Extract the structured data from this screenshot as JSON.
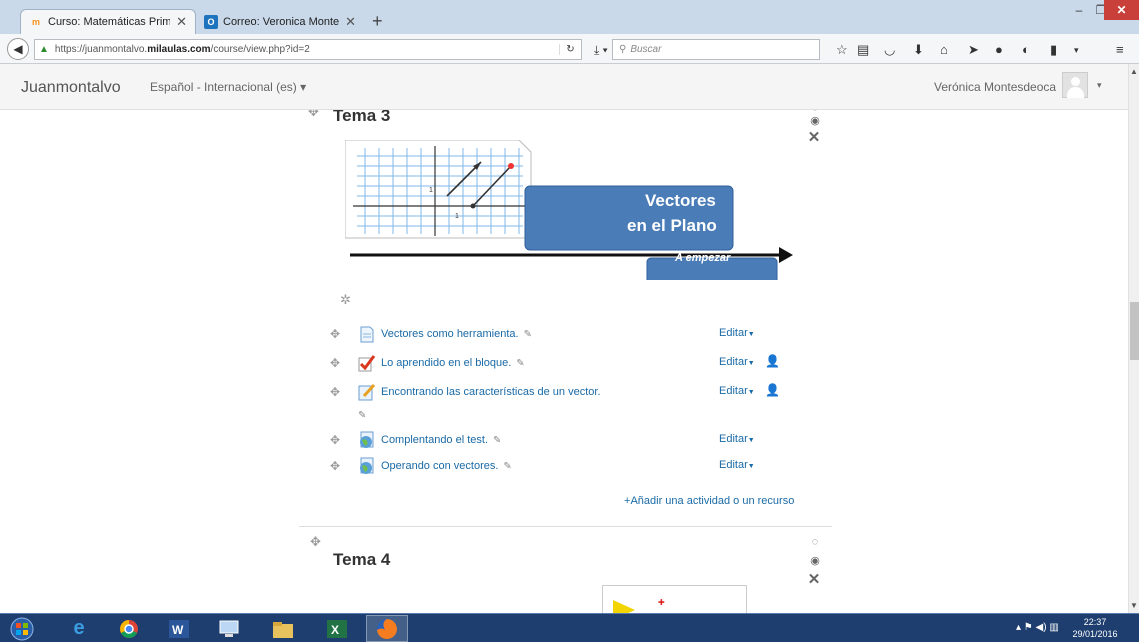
{
  "browser": {
    "tabs": [
      {
        "label": "Curso: Matemáticas Prime...",
        "icon": "moodle-favicon",
        "active": true
      },
      {
        "label": "Correo: Veronica Montesd...",
        "icon": "outlook-favicon",
        "active": false
      }
    ],
    "new_tab_label": "+",
    "close_tab_glyph": "✕",
    "url_prefix": "https://juanmontalvo.",
    "url_domain": "milaulas.com",
    "url_path": "/course/view.php?id=2",
    "search_placeholder": "Buscar",
    "window_controls": {
      "minimize": "–",
      "maximize": "❐",
      "close": "✕"
    }
  },
  "moodle": {
    "site_name": "Juanmontalvo",
    "language": "Español - Internacional (es) ▾",
    "user_name": "Verónica Montesdeoca",
    "user_menu_caret": "▾"
  },
  "sections": [
    {
      "title": "Tema 3",
      "banner": {
        "title_line1": "Vectores",
        "title_line2": "en el Plano",
        "button": "A empezar"
      },
      "activities": [
        {
          "name": "Vectores como herramienta.",
          "icon": "page-icon",
          "edit": "Editar",
          "assign_role": false
        },
        {
          "name": "Lo aprendido en el bloque.",
          "icon": "checkmark-icon",
          "edit": "Editar",
          "assign_role": true
        },
        {
          "name": "Encontrando las características de un vector.",
          "icon": "assignment-pencil-icon",
          "edit": "Editar",
          "assign_role": true
        },
        {
          "name": "Complentando el test.",
          "icon": "globe-icon",
          "edit": "Editar",
          "assign_role": false
        },
        {
          "name": "Operando con vectores.",
          "icon": "globe-icon",
          "edit": "Editar",
          "assign_role": false
        }
      ],
      "add_activity": "Añadir una actividad o un recurso"
    },
    {
      "title": "Tema 4"
    }
  ],
  "taskbar": {
    "clock_time": "22:37",
    "clock_date": "29/01/2016"
  },
  "colors": {
    "link": "#1a6aa6",
    "banner_blue": "#4a7cb8",
    "titlebar": "#c9d9ea",
    "taskbar": "#1d3e6e"
  }
}
